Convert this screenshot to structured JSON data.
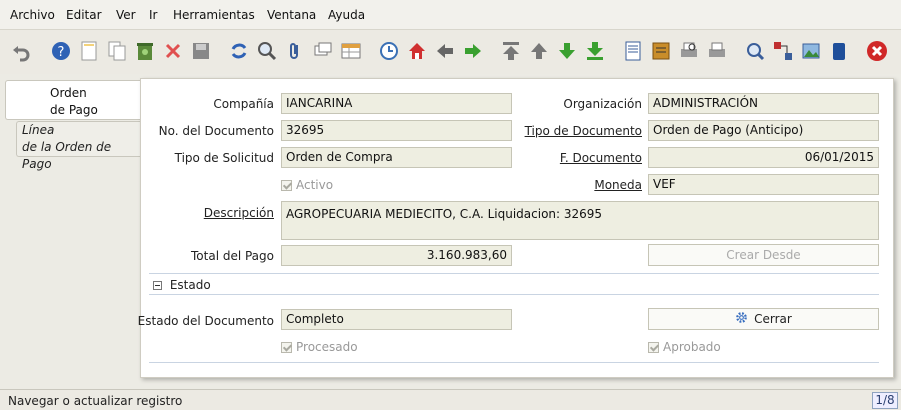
{
  "menu": [
    "Archivo",
    "Editar",
    "Ver",
    "Ir",
    "Herramientas",
    "Ventana",
    "Ayuda"
  ],
  "tabs": {
    "active": [
      "Orden",
      "de Pago"
    ],
    "second": [
      "Línea",
      "de la Orden de Pago"
    ]
  },
  "form": {
    "company_label": "Compañía",
    "company_value": "IANCARINA",
    "org_label": "Organización",
    "org_value": "ADMINISTRACIÓN",
    "docno_label": "No. del Documento",
    "docno_value": "32695",
    "doctype_label": "Tipo de Documento",
    "doctype_value": "Orden de Pago (Anticipo)",
    "reqtype_label": "Tipo de Solicitud",
    "reqtype_value": "Orden de Compra",
    "docdate_label": "F. Documento",
    "docdate_value": "06/01/2015",
    "active_label": "Activo",
    "currency_label": "Moneda",
    "currency_value": "VEF",
    "desc_label": "Descripción",
    "desc_value": "AGROPECUARIA MEDIECITO, C.A. Liquidacion: 32695",
    "total_label": "Total del Pago",
    "total_value": "3.160.983,60",
    "create_from_label": "Crear Desde",
    "section_label": "Estado",
    "docstatus_label": "Estado del Documento",
    "docstatus_value": "Completo",
    "close_label": "Cerrar",
    "processed_label": "Procesado",
    "approved_label": "Aprobado"
  },
  "status": {
    "message": "Navegar o actualizar registro",
    "record": "1/8"
  }
}
